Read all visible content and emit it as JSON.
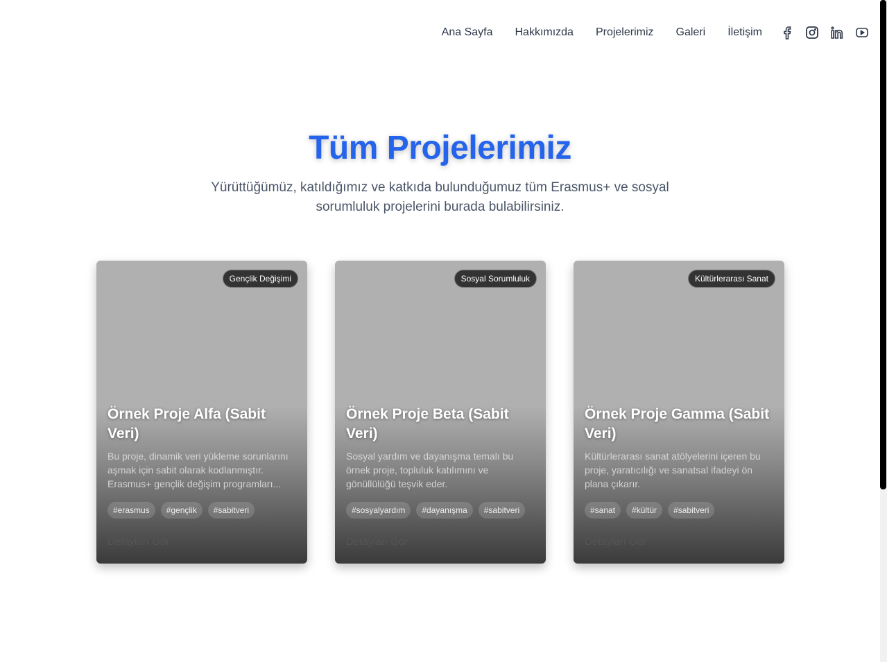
{
  "nav": {
    "items": [
      "Ana Sayfa",
      "Hakkımızda",
      "Projelerimiz",
      "Galeri",
      "İletişim"
    ],
    "social": [
      "facebook-icon",
      "instagram-icon",
      "linkedin-icon",
      "youtube-icon"
    ]
  },
  "hero": {
    "title": "Tüm Projelerimiz",
    "subtitle": "Yürüttüğümüz, katıldığımız ve katkıda bulunduğumuz tüm Erasmus+ ve sosyal sorumluluk projelerini burada bulabilirsiniz."
  },
  "colors": {
    "accent": "#2563eb"
  },
  "cards": [
    {
      "badge": "Gençlik Değişimi",
      "title": "Örnek Proje Alfa (Sabit Veri)",
      "desc": "Bu proje, dinamik veri yükleme sorunlarını aşmak için sabit olarak kodlanmıştır. Erasmus+ gençlik değişim programları...",
      "tags": [
        "#erasmus",
        "#gençlik",
        "#sabitveri"
      ],
      "link": "Detayları Gör"
    },
    {
      "badge": "Sosyal Sorumluluk",
      "title": "Örnek Proje Beta (Sabit Veri)",
      "desc": "Sosyal yardım ve dayanışma temalı bu örnek proje, topluluk katılımını ve gönüllülüğü teşvik eder.",
      "tags": [
        "#sosyalyardım",
        "#dayanışma",
        "#sabitveri"
      ],
      "link": "Detayları Gör"
    },
    {
      "badge": "Kültürlerarası Sanat",
      "title": "Örnek Proje Gamma (Sabit Veri)",
      "desc": "Kültürlerarası sanat atölyelerini içeren bu proje, yaratıcılığı ve sanatsal ifadeyi ön plana çıkarır.",
      "tags": [
        "#sanat",
        "#kültür",
        "#sabitveri"
      ],
      "link": "Detayları Gör"
    }
  ]
}
